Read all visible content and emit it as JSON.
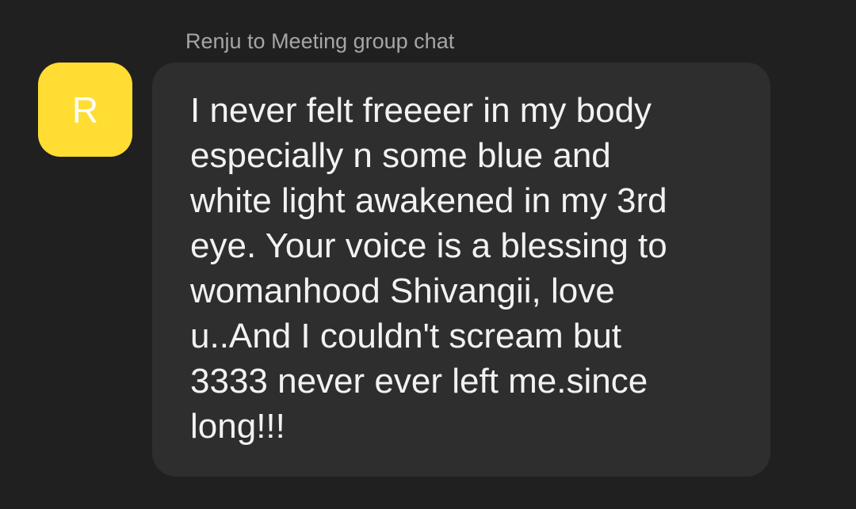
{
  "message": {
    "sender_line": "Renju to Meeting group chat",
    "avatar": {
      "initial": "R",
      "color": "#ffdd33"
    },
    "lines": [
      "I never felt freeeer in my body",
      "especially n some blue and",
      "white light awakened in my 3rd",
      "eye. Your voice is a blessing to",
      "womanhood Shivangii, love",
      "u..And I couldn't scream but",
      "3333 never ever left me.since",
      "long!!!"
    ]
  }
}
